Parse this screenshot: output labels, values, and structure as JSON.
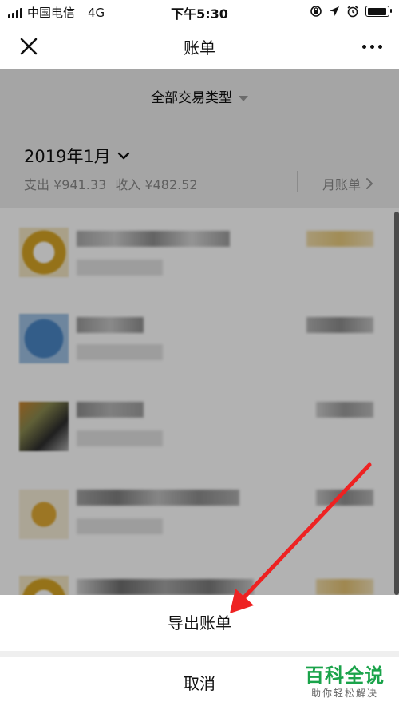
{
  "status_bar": {
    "carrier": "中国电信",
    "network": "4G",
    "time": "下午5:30",
    "battery_level": 0.95
  },
  "nav": {
    "title": "账单",
    "close_icon": "close-icon",
    "more_icon": "more-dots-icon"
  },
  "filter": {
    "label": "全部交易类型"
  },
  "month": {
    "title": "2019年1月",
    "expense": "支出 ¥941.33",
    "income": "收入 ¥482.52",
    "monthly_bill": "月账单"
  },
  "list": {
    "row_count": 5,
    "obscured": true
  },
  "sheet": {
    "export_label": "导出账单",
    "cancel_label": "取消"
  },
  "watermark": {
    "main": "百科全说",
    "sub": "助你轻松解决"
  },
  "colors": {
    "annotation_arrow": "#ee2222",
    "watermark_green": "#1aa34a"
  }
}
